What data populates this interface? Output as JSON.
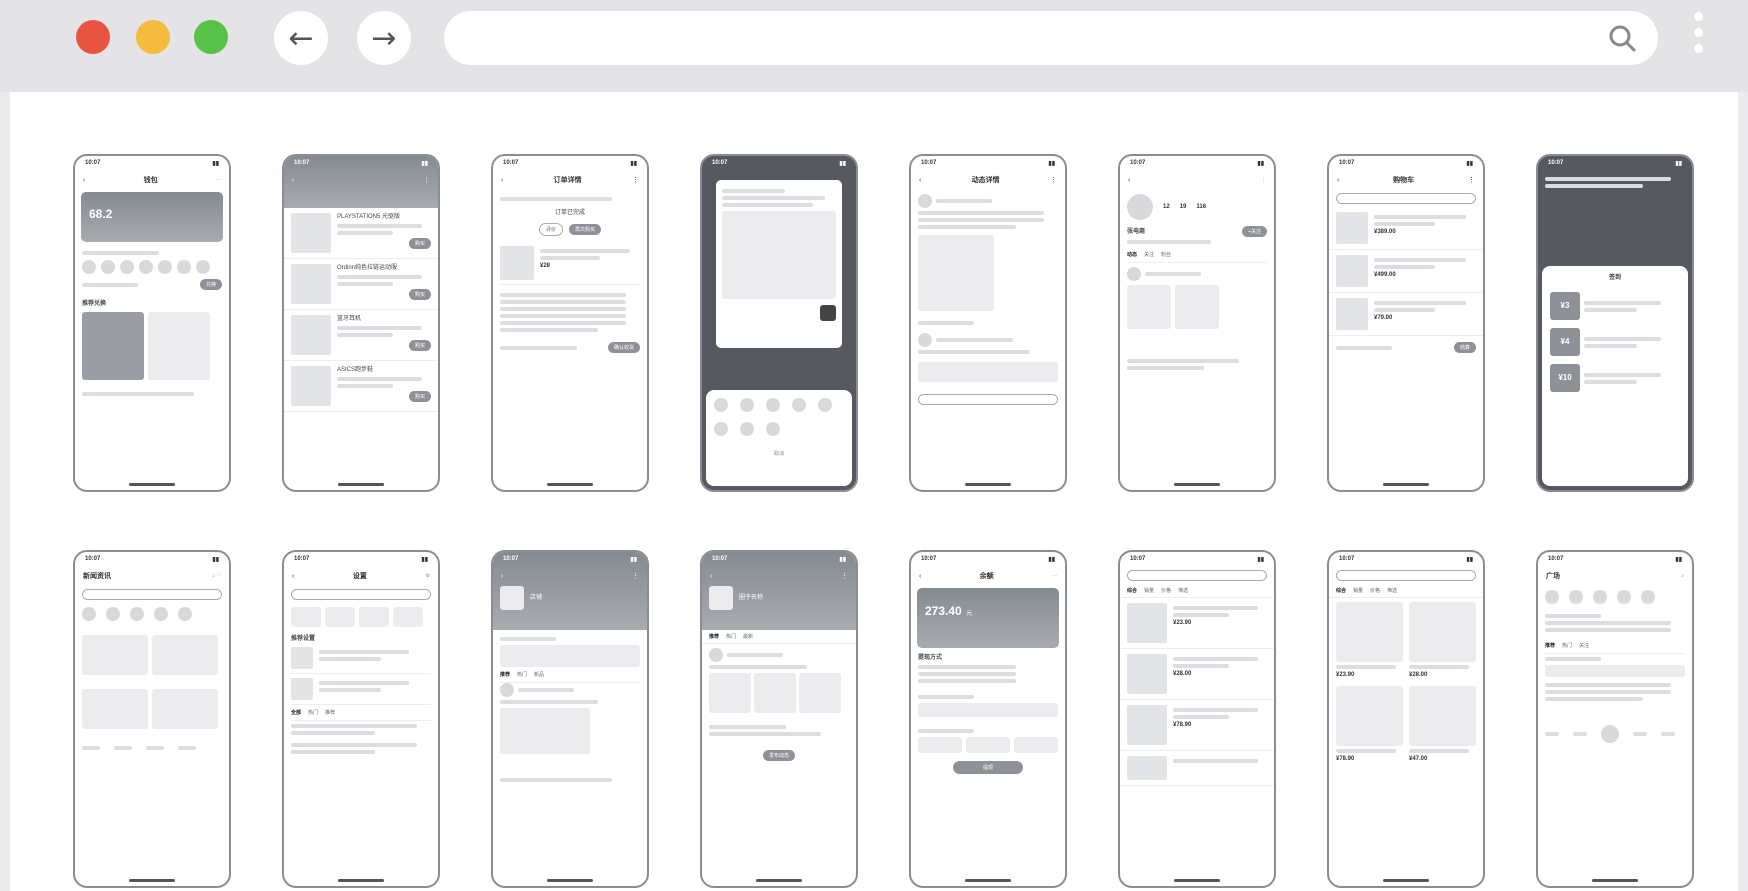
{
  "browser": {
    "back_glyph": "←",
    "forward_glyph": "→",
    "url": ""
  },
  "colors": {
    "close": "#e8543f",
    "minimize": "#f4bb3e",
    "maximize": "#58c14a"
  },
  "status_time": "10:07",
  "screens": {
    "s1": {
      "title": "钱包",
      "amount": "68.2",
      "section": "推荐兑换"
    },
    "s2": {
      "items": [
        "PLAYSTATION5 光驱版",
        "Ordinn纯色拉链运动服",
        "蓝牙耳机",
        "ASICS跑步鞋"
      ]
    },
    "s3": {
      "title": "订单详情",
      "status": "订单已完成",
      "btn": "再次购买"
    },
    "s5": {
      "title": "动态详情"
    },
    "s6": {
      "name": "张电商",
      "stats": [
        "12",
        "19",
        "116"
      ],
      "follow": "+关注"
    },
    "s7": {
      "title": "购物车",
      "prices": [
        "¥389.00",
        "¥499.00",
        "¥79.00"
      ],
      "checkout": "结算"
    },
    "s8": {
      "title": "签到",
      "coupons": [
        "¥3",
        "¥4",
        "¥10"
      ]
    },
    "s9": {
      "title": "新闻资讯"
    },
    "s10": {
      "title": "设置",
      "section": "推荐设置"
    },
    "s11": {
      "title": "店铺"
    },
    "s12": {
      "title": "圈子名称"
    },
    "s13": {
      "title": "余额",
      "amount": "273.40",
      "unit": "元",
      "section": "提现方式"
    },
    "s14": {
      "prices": [
        "¥23.90",
        "¥28.00",
        "¥78.90"
      ]
    },
    "s15": {
      "prices": [
        "¥23.90",
        "¥28.00",
        "¥78.90",
        "¥47.00"
      ]
    },
    "s16": {
      "title": "广场"
    }
  }
}
